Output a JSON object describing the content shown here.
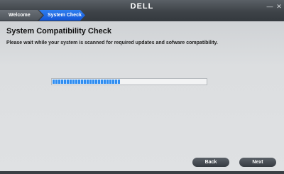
{
  "titlebar": {
    "steps": [
      {
        "label": "Welcome",
        "state": "completed"
      },
      {
        "label": "System Check",
        "state": "active"
      }
    ],
    "brand": "DELL",
    "minimize_glyph": "—",
    "close_glyph": "✕"
  },
  "main": {
    "heading": "System Compatibility Check",
    "description": "Please wait while your system is scanned for required updates and sofware compatibility.",
    "progress_fraction": 0.44
  },
  "footer": {
    "back_label": "Back",
    "next_label": "Next"
  },
  "colors": {
    "accent": "#1a5ee0",
    "progress": "#2f8df0"
  }
}
